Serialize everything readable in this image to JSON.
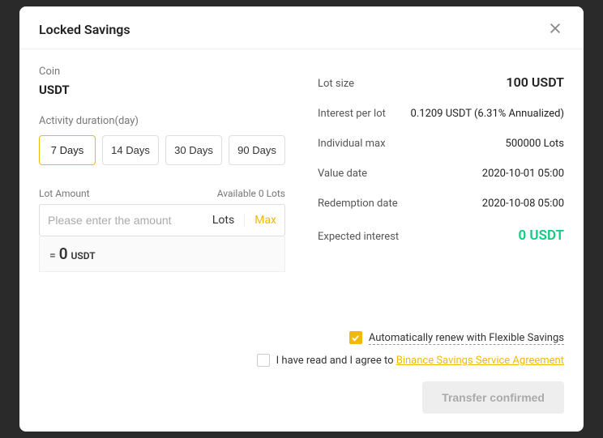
{
  "modal": {
    "title": "Locked Savings"
  },
  "coin": {
    "label": "Coin",
    "value": "USDT"
  },
  "duration": {
    "label": "Activity duration(day)",
    "options": [
      "7 Days",
      "14 Days",
      "30 Days",
      "90 Days"
    ]
  },
  "lot": {
    "label": "Lot Amount",
    "available": "Available 0 Lots",
    "placeholder": "Please enter the amount",
    "unit": "Lots",
    "max_label": "Max",
    "equals_sign": "=",
    "equals_value": "0",
    "equals_unit": "USDT"
  },
  "info": {
    "lot_size": {
      "label": "Lot size",
      "value": "100 USDT"
    },
    "interest_per_lot": {
      "label": "Interest per lot",
      "value": "0.1209 USDT (6.31% Annualized)"
    },
    "individual_max": {
      "label": "Individual max",
      "value": "500000 Lots"
    },
    "value_date": {
      "label": "Value date",
      "value": "2020-10-01 05:00"
    },
    "redemption_date": {
      "label": "Redemption date",
      "value": "2020-10-08 05:00"
    },
    "expected_interest": {
      "label": "Expected interest",
      "value": "0 USDT"
    }
  },
  "consent": {
    "auto_renew": "Automatically renew with Flexible Savings",
    "agree_prefix": "I have read and I agree to ",
    "agree_link": "Binance Savings Service Agreement"
  },
  "footer": {
    "confirm": "Transfer confirmed"
  }
}
